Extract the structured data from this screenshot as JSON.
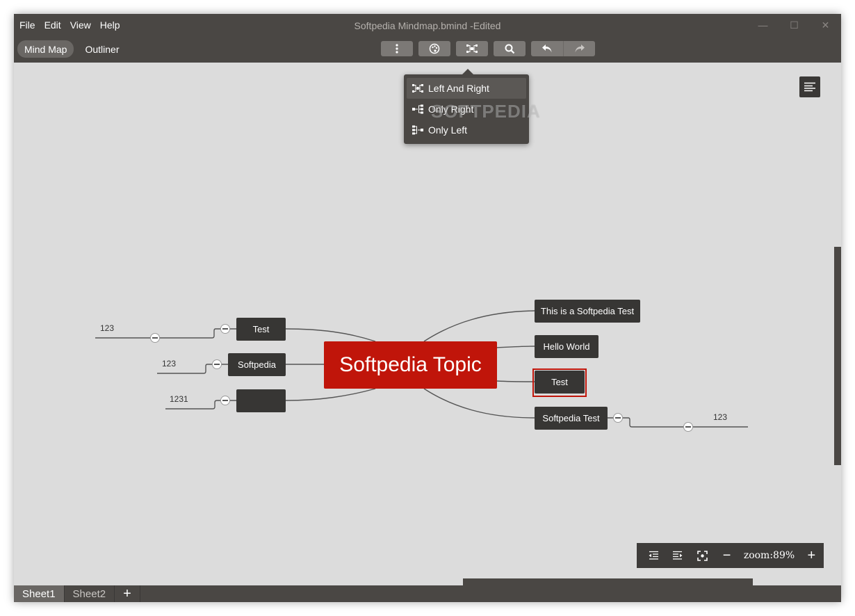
{
  "app": {
    "title": "Softpedia Mindmap.bmind -Edited"
  },
  "menu": [
    "File",
    "Edit",
    "View",
    "Help"
  ],
  "window_controls": {
    "minimize": "—",
    "maximize": "☐",
    "close": "✕"
  },
  "view_tabs": [
    {
      "label": "Mind Map",
      "active": true
    },
    {
      "label": "Outliner",
      "active": false
    }
  ],
  "toolbar_icons": [
    "more-vertical-icon",
    "palette-icon",
    "layout-icon",
    "search-icon",
    "undo-icon",
    "redo-icon"
  ],
  "layout_menu": {
    "items": [
      {
        "label": "Left And Right",
        "icon": "layout-both-icon",
        "active": true
      },
      {
        "label": "Only Right",
        "icon": "layout-right-icon",
        "active": false
      },
      {
        "label": "Only Left",
        "icon": "layout-left-icon",
        "active": false
      }
    ]
  },
  "watermark": "SOFTPEDIA",
  "mindmap": {
    "root": "Softpedia Topic",
    "right_nodes": [
      "This is a Softpedia Test",
      "Hello World",
      "Test",
      "Softpedia Test"
    ],
    "left_nodes": [
      "Test",
      "Softpedia",
      ""
    ],
    "leaf_labels": {
      "left_test": "123",
      "left_softpedia": "123",
      "left_empty": "1231",
      "right_softpedia_test": "123"
    },
    "selected_node": "Test"
  },
  "zoom": {
    "label": "zoom:89%",
    "minus": "−",
    "plus": "+"
  },
  "sheets": [
    {
      "label": "Sheet1",
      "active": true
    },
    {
      "label": "Sheet2",
      "active": false
    }
  ],
  "add_sheet": "+",
  "colors": {
    "chrome": "#4a4744",
    "canvas": "#dcdcdc",
    "root": "#c0150a",
    "node": "#373634"
  }
}
